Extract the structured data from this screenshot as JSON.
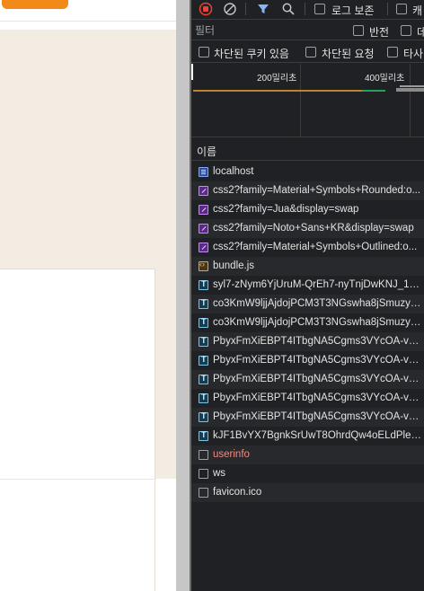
{
  "page": {
    "header_button_label": "",
    "header_link_label": "",
    "colors": {
      "accent": "#f28a1a",
      "beige": "#f3ece3"
    }
  },
  "devtools": {
    "toolbar": {
      "record_icon": "record-stop-icon",
      "clear_icon": "clear-block-icon",
      "filter_icon": "funnel-filter-icon",
      "search_icon": "search-icon",
      "preserve_log_label": "로그 보존",
      "disable_cache_label": "캐"
    },
    "filter": {
      "placeholder": "필터",
      "invert_label": "반전",
      "more_label": "데"
    },
    "checkboxes": {
      "blocked_cookies_label": "차단된 쿠키 있음",
      "blocked_requests_label": "차단된 요청",
      "third_party_label": "타사"
    },
    "overview": {
      "tick_1": "200밀리초",
      "tick_2": "400밀리초"
    },
    "columns": {
      "name": "이름"
    },
    "requests": [
      {
        "type": "doc",
        "name": "localhost"
      },
      {
        "type": "css",
        "name": "css2?family=Material+Symbols+Rounded:o..."
      },
      {
        "type": "css",
        "name": "css2?family=Jua&display=swap"
      },
      {
        "type": "css",
        "name": "css2?family=Noto+Sans+KR&display=swap"
      },
      {
        "type": "css",
        "name": "css2?family=Material+Symbols+Outlined:o..."
      },
      {
        "type": "js",
        "name": "bundle.js"
      },
      {
        "type": "font",
        "name": "syl7-zNym6YjUruM-QrEh7-nyTnjDwKNJ_190..."
      },
      {
        "type": "font",
        "name": "co3KmW9ljjAjdojPCM3T3NGswha8jSmuzy4j..."
      },
      {
        "type": "font",
        "name": "co3KmW9ljjAjdojPCM3T3NGswha8jSmuzy4j..."
      },
      {
        "type": "font",
        "name": "PbyxFmXiEBPT4ITbgNA5Cgms3VYcOA-vvnI..."
      },
      {
        "type": "font",
        "name": "PbyxFmXiEBPT4ITbgNA5Cgms3VYcOA-vvnI..."
      },
      {
        "type": "font",
        "name": "PbyxFmXiEBPT4ITbgNA5Cgms3VYcOA-vvnI..."
      },
      {
        "type": "font",
        "name": "PbyxFmXiEBPT4ITbgNA5Cgms3VYcOA-vvnI..."
      },
      {
        "type": "font",
        "name": "PbyxFmXiEBPT4ITbgNA5Cgms3VYcOA-vvnI..."
      },
      {
        "type": "font",
        "name": "kJF1BvYX7BgnkSrUwT8OhrdQw4oELdPleeII..."
      },
      {
        "type": "blank-error",
        "name": "userinfo"
      },
      {
        "type": "blank",
        "name": "ws"
      },
      {
        "type": "blank",
        "name": "favicon.ico"
      }
    ],
    "colors": {
      "panel_bg": "#202124",
      "text": "#e3e3e3",
      "error_text": "#f28b82",
      "record_red": "#ea4335",
      "filter_blue": "#8ab4f8"
    }
  }
}
